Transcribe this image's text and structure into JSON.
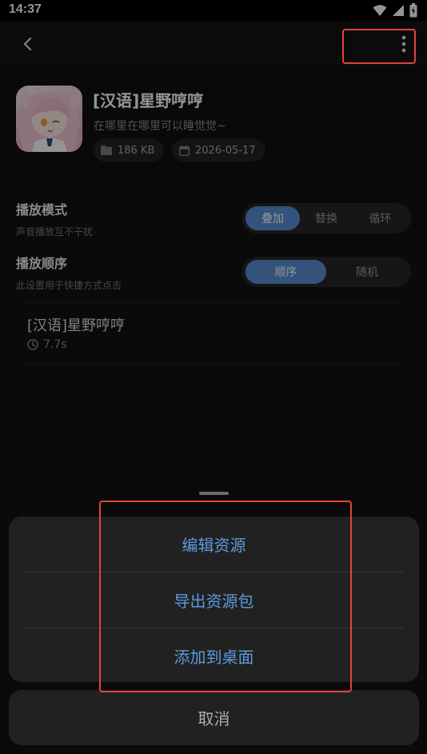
{
  "status_bar": {
    "time": "14:37",
    "icons": [
      "wifi-icon",
      "signal-icon",
      "battery-icon"
    ]
  },
  "app_bar": {
    "back_icon": "chevron-left-icon",
    "more_icon": "more-vertical-icon"
  },
  "sound": {
    "title": "[汉语]星野哼哼",
    "subtitle": "在哪里在哪里可以睡觉觉~",
    "size": "186 KB",
    "date": "2026-05-17",
    "size_icon": "folder-icon",
    "date_icon": "calendar-icon"
  },
  "settings": {
    "play_mode": {
      "label": "播放模式",
      "description": "声音播放互不干扰",
      "options": [
        "叠加",
        "替换",
        "循环"
      ],
      "selected": "叠加"
    },
    "play_order": {
      "label": "播放顺序",
      "description": "此设置用于快捷方式点击",
      "options": [
        "顺序",
        "随机"
      ],
      "selected": "顺序"
    }
  },
  "clip": {
    "title": "[汉语]星野哼哼",
    "duration": "7.7s",
    "duration_icon": "clock-icon"
  },
  "sheet": {
    "actions": [
      "编辑资源",
      "导出资源包",
      "添加到桌面"
    ],
    "cancel": "取消"
  },
  "colors": {
    "accent": "#5b8fd6",
    "sheet_text": "#5d99dd",
    "highlight": "#e0443a",
    "background": "#121212"
  }
}
